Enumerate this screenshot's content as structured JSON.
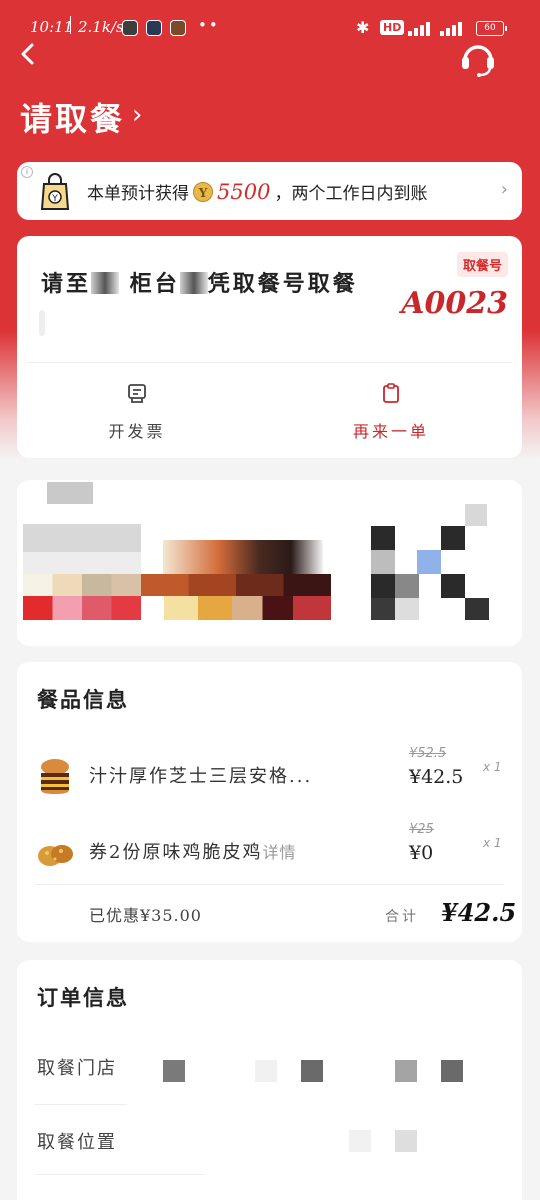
{
  "status_bar": {
    "time": "10:11",
    "net_speed": "2.1k/s",
    "dots": "••",
    "bluetooth": "✱",
    "hd": "HD",
    "battery": "60"
  },
  "header": {
    "title": "请取餐",
    "back_icon": "chevron-left-icon",
    "service_icon": "headset-icon"
  },
  "points_banner": {
    "text_before": "本单预计获得",
    "coin_label": "Y",
    "amount": "5500",
    "text_after": "，两个工作日内到账"
  },
  "pickup": {
    "message_parts": [
      "请至",
      "柜台",
      "凭取餐号取餐"
    ],
    "badge": "取餐号",
    "code": "A0023",
    "actions": {
      "invoice": "开发票",
      "reorder": "再来一单"
    }
  },
  "products": {
    "title": "餐品信息",
    "items": [
      {
        "name": "汁汁厚作芝士三层安格...",
        "original_price": "¥52.5",
        "price": "¥42.5",
        "qty": "x 1",
        "detail": ""
      },
      {
        "name": "券2份原味鸡脆皮鸡",
        "original_price": "¥25",
        "price": "¥0",
        "qty": "x 1",
        "detail": "详情"
      }
    ],
    "saved": "已优惠¥35.00",
    "total_label": "合计",
    "total": "¥42.5"
  },
  "order_info": {
    "title": "订单信息",
    "rows": [
      {
        "label": "取餐门店"
      },
      {
        "label": "取餐位置"
      }
    ]
  },
  "colors": {
    "brand_red": "#dc3336",
    "price_red": "#c9272b",
    "background": "#f4f4f4"
  }
}
